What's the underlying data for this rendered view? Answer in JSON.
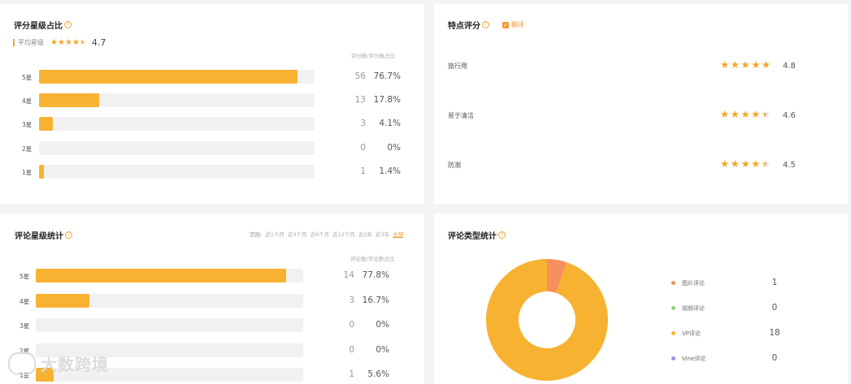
{
  "rating_distribution": {
    "title": "评分星级占比",
    "avg_label": "平均星级",
    "avg_value": "4.7",
    "avg_stars": 4.7,
    "column_header": "评分数/评分数占比",
    "rows": [
      {
        "label": "5星",
        "count": "56",
        "percent": "76.7%",
        "ratio": 0.937
      },
      {
        "label": "4星",
        "count": "13",
        "percent": "17.8%",
        "ratio": 0.218
      },
      {
        "label": "3星",
        "count": "3",
        "percent": "4.1%",
        "ratio": 0.05
      },
      {
        "label": "2星",
        "count": "0",
        "percent": "0%",
        "ratio": 0
      },
      {
        "label": "1星",
        "count": "1",
        "percent": "1.4%",
        "ratio": 0.017
      }
    ]
  },
  "feature_rating": {
    "title": "特点评分",
    "translate_label": "翻译",
    "translate_checked": true,
    "items": [
      {
        "label": "旅行用",
        "value": "4.8",
        "stars": 5
      },
      {
        "label": "易于清洁",
        "value": "4.6",
        "stars": 4.5
      },
      {
        "label": "防潮",
        "value": "4.5",
        "stars": 4.5
      }
    ]
  },
  "review_stats": {
    "title": "评论星级统计",
    "range_label": "范围:",
    "range_options": [
      "近1个月",
      "近3个月",
      "近6个月",
      "近12个月",
      "近2年",
      "近3年",
      "全部"
    ],
    "range_active": "全部",
    "column_header": "评论数/评论数占比",
    "rows": [
      {
        "label": "5星",
        "count": "14",
        "percent": "77.8%",
        "ratio": 0.937
      },
      {
        "label": "4星",
        "count": "3",
        "percent": "16.7%",
        "ratio": 0.2
      },
      {
        "label": "3星",
        "count": "0",
        "percent": "0%",
        "ratio": 0
      },
      {
        "label": "2星",
        "count": "0",
        "percent": "0%",
        "ratio": 0
      },
      {
        "label": "1星",
        "count": "1",
        "percent": "5.6%",
        "ratio": 0.067
      }
    ]
  },
  "review_types": {
    "title": "评论类型统计",
    "items": [
      {
        "label": "图片评论",
        "value": "1",
        "color": "#f78f5e",
        "num": 1
      },
      {
        "label": "视频评论",
        "value": "0",
        "color": "#8fd07a",
        "num": 0
      },
      {
        "label": "VP评论",
        "value": "18",
        "color": "#f7b232",
        "num": 18
      },
      {
        "label": "Vine评论",
        "value": "0",
        "color": "#9d8ee6",
        "num": 0
      }
    ]
  },
  "watermark": {
    "text": "大数跨境"
  },
  "colors": {
    "accent": "#f39a2f",
    "bar": "#f7b232",
    "track": "#f1f1f1"
  }
}
